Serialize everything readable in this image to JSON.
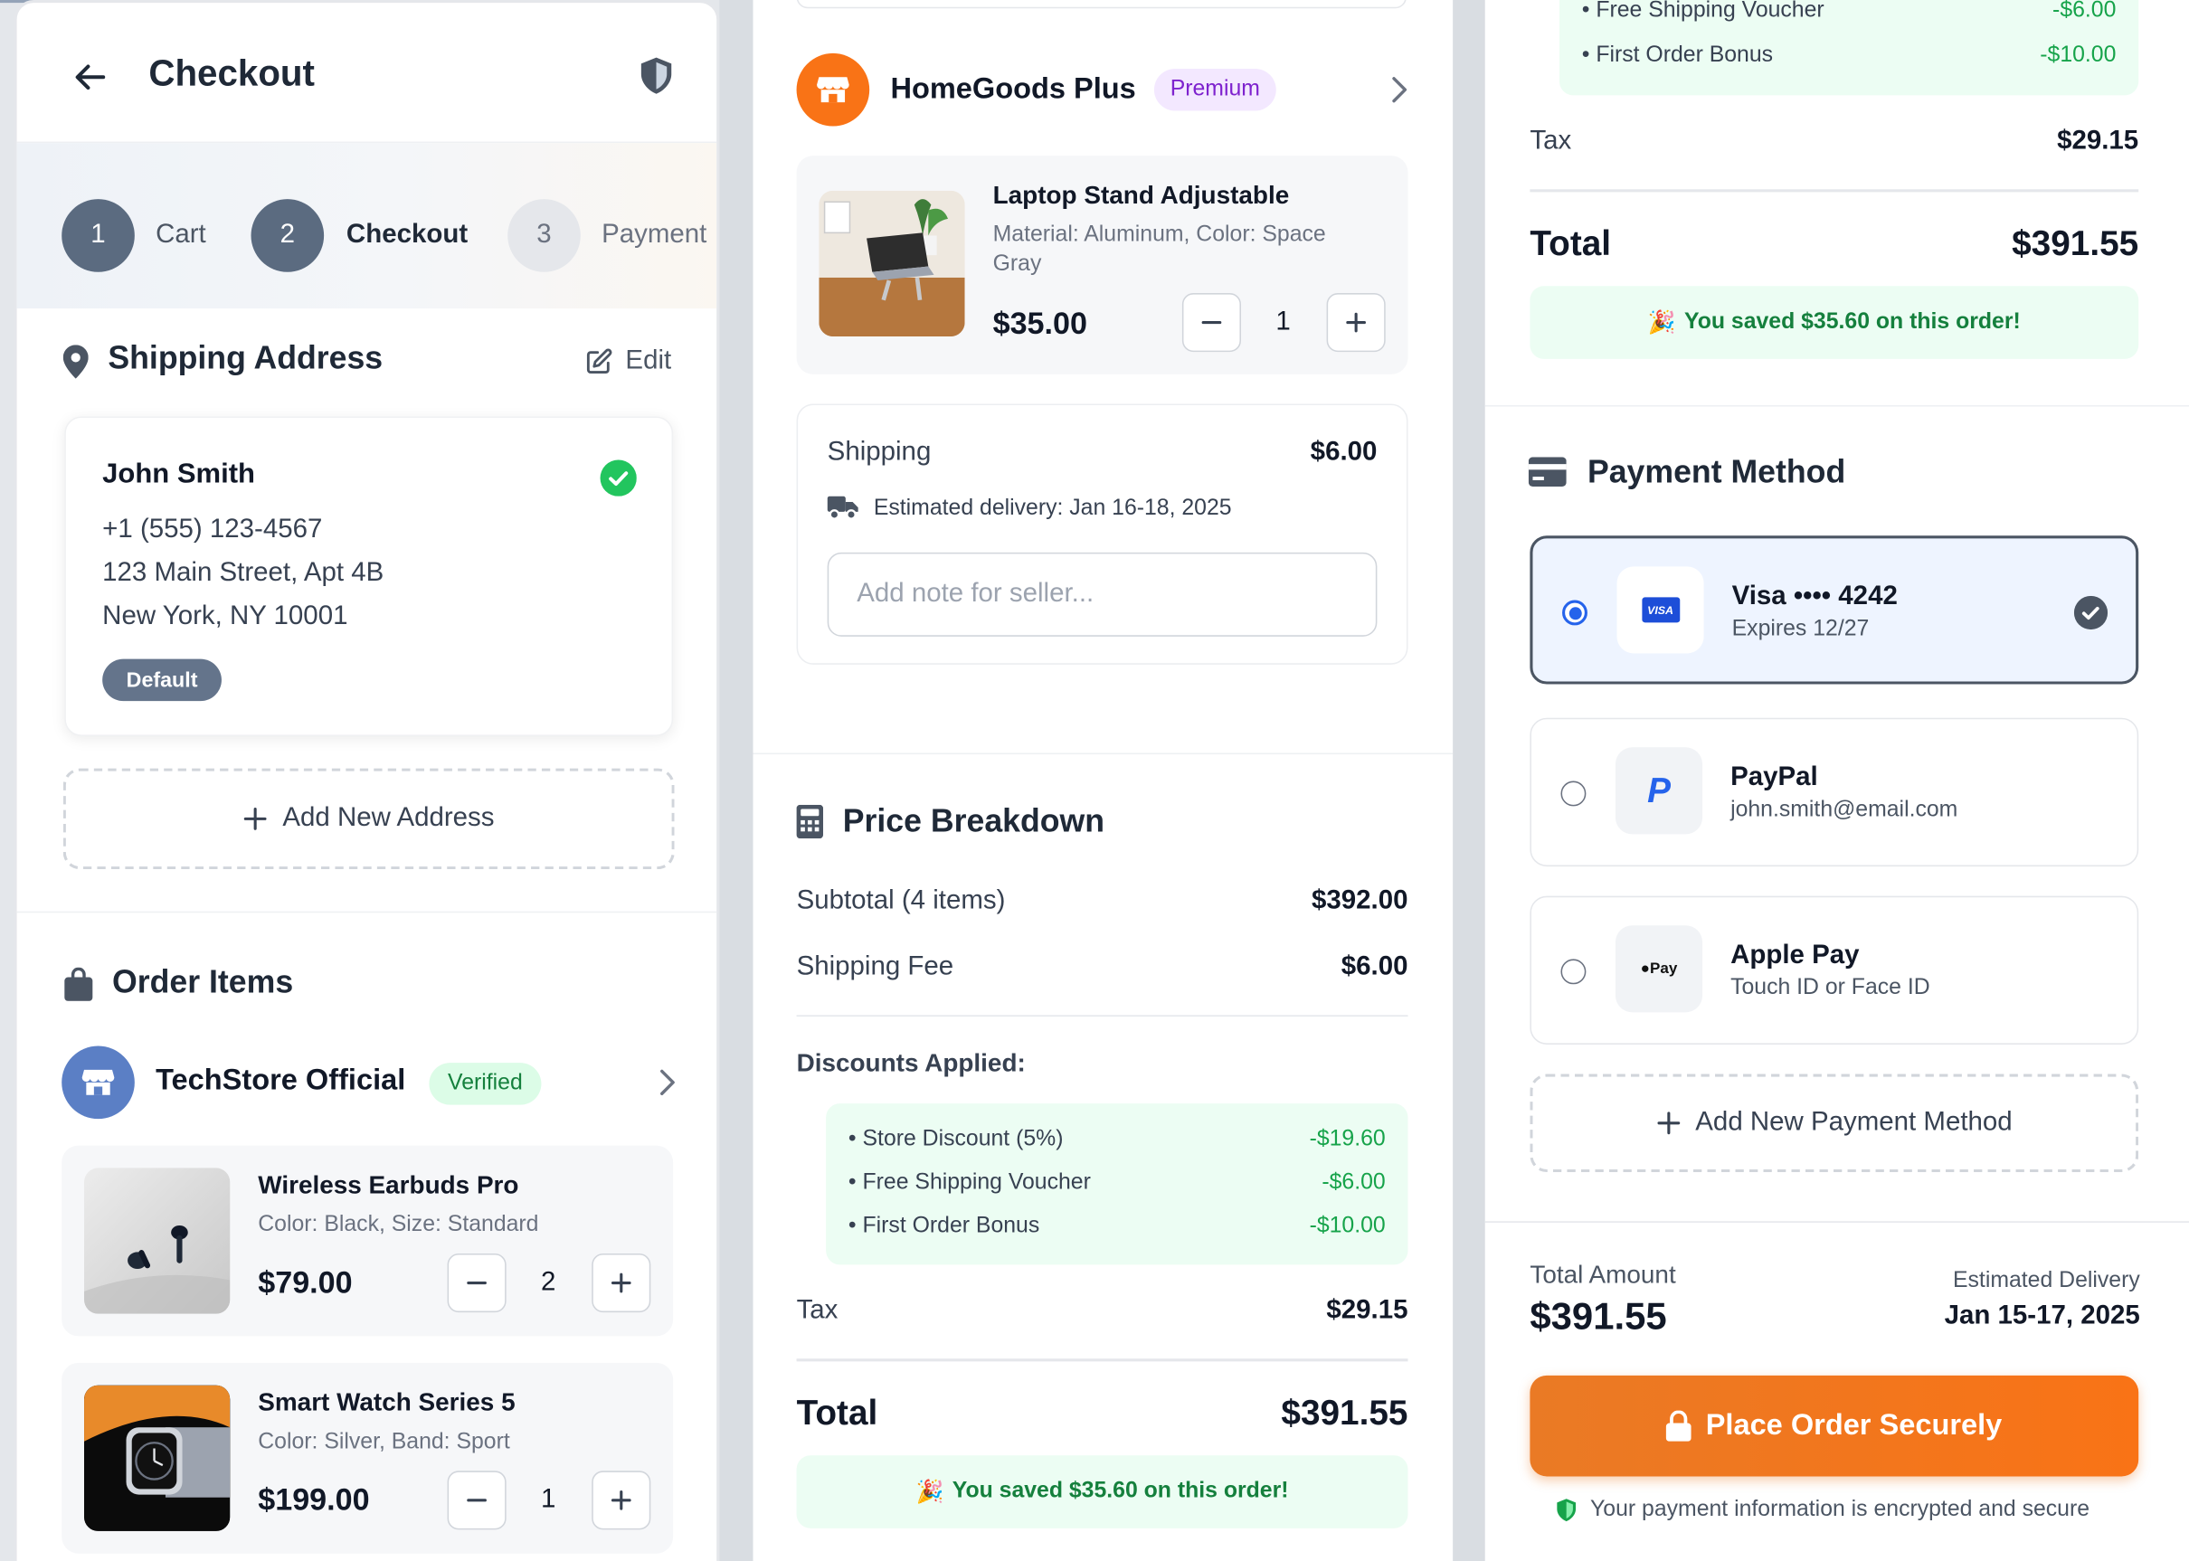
{
  "header": {
    "title": "Checkout"
  },
  "stepper": {
    "steps": [
      {
        "number": "1",
        "label": "Cart"
      },
      {
        "number": "2",
        "label": "Checkout"
      },
      {
        "number": "3",
        "label": "Payment"
      }
    ]
  },
  "shipping_address": {
    "title": "Shipping Address",
    "edit_label": "Edit",
    "name": "John Smith",
    "phone": "+1 (555) 123-4567",
    "street": "123 Main Street, Apt 4B",
    "city": "New York, NY 10001",
    "badge": "Default",
    "add_new_label": "Add New Address"
  },
  "order_items": {
    "title": "Order Items",
    "stores": [
      {
        "name": "TechStore Official",
        "badge": "Verified",
        "items": [
          {
            "name": "Wireless Earbuds Pro",
            "variant": "Color: Black, Size: Standard",
            "price": "$79.00",
            "qty": "2"
          },
          {
            "name": "Smart Watch Series 5",
            "variant": "Color: Silver, Band: Sport",
            "price": "$199.00",
            "qty": "1"
          }
        ]
      },
      {
        "name": "HomeGoods Plus",
        "badge": "Premium",
        "items": [
          {
            "name": "Laptop Stand Adjustable",
            "variant": "Material: Aluminum, Color: Space Gray",
            "price": "$35.00",
            "qty": "1"
          }
        ],
        "shipping_label": "Shipping",
        "shipping_value": "$6.00",
        "delivery": "Estimated delivery: Jan 16-18, 2025",
        "note_placeholder": "Add note for seller..."
      }
    ]
  },
  "price_breakdown": {
    "title": "Price Breakdown",
    "subtotal_label": "Subtotal (4 items)",
    "subtotal_value": "$392.00",
    "shipping_fee_label": "Shipping Fee",
    "shipping_fee_value": "$6.00",
    "discounts_label": "Discounts Applied:",
    "discounts": [
      {
        "label": "• Store Discount (5%)",
        "value": "-$19.60"
      },
      {
        "label": "• Free Shipping Voucher",
        "value": "-$6.00"
      },
      {
        "label": "• First Order Bonus",
        "value": "-$10.00"
      }
    ],
    "tax_label": "Tax",
    "tax_value": "$29.15",
    "total_label": "Total",
    "total_value": "$391.55",
    "saved_message": "You saved $35.60 on this order!",
    "saved_emoji": "🎉"
  },
  "payment": {
    "title": "Payment Method",
    "methods": [
      {
        "name": "Visa •••• 4242",
        "sub": "Expires 12/27",
        "logo": "VISA",
        "selected": true
      },
      {
        "name": "PayPal",
        "sub": "john.smith@email.com",
        "logo": "P",
        "selected": false
      },
      {
        "name": "Apple Pay",
        "sub": "Touch ID or Face ID",
        "logo": "Pay",
        "selected": false
      }
    ],
    "add_new_label": "Add New Payment Method"
  },
  "footer": {
    "total_amount_label": "Total Amount",
    "total_amount_value": "$391.55",
    "delivery_label": "Estimated Delivery",
    "delivery_value": "Jan 15-17, 2025",
    "place_order_label": "Place Order Securely",
    "secure_note": "Your payment information is encrypted and secure"
  },
  "colors": {
    "accent_orange": "#f97316",
    "step_active": "#5b6b80",
    "success_green": "#16a34a",
    "premium_purple": "#7e22ce",
    "link_blue": "#2563eb"
  },
  "icons": [
    "back-arrow-icon",
    "shield-icon",
    "map-pin-icon",
    "edit-icon",
    "check-circle-icon",
    "plus-icon",
    "shopping-bag-icon",
    "store-icon",
    "chevron-right-icon",
    "minus-icon",
    "truck-icon",
    "calculator-icon",
    "credit-card-icon",
    "lock-icon"
  ]
}
